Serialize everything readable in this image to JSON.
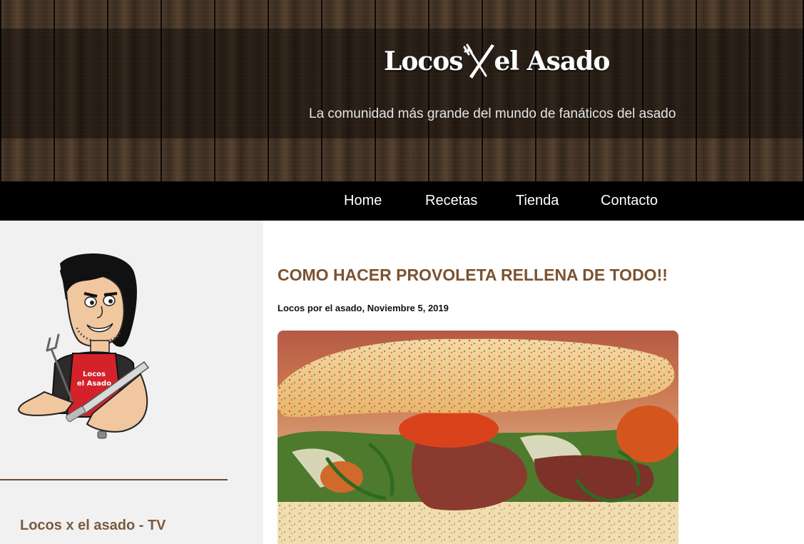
{
  "header": {
    "logo_text_left": "Locos",
    "logo_text_right": "el Asado",
    "tagline": "La comunidad más grande del mundo de fanáticos del asado"
  },
  "nav": {
    "items": [
      "Home",
      "Recetas",
      "Tienda",
      "Contacto"
    ]
  },
  "sidebar": {
    "mascot_apron_line1": "Locos",
    "mascot_apron_line2": "el Asado",
    "heading": "Locos x el asado - TV"
  },
  "post": {
    "title": "COMO HACER PROVOLETA RELLENA DE TODO!!",
    "meta": "Locos por el asado, Noviembre 5, 2019"
  },
  "colors": {
    "accent_brown": "#7b5230",
    "nav_bg": "#000000",
    "sidebar_bg": "#f1f1f1",
    "divider": "#6b4a35"
  }
}
